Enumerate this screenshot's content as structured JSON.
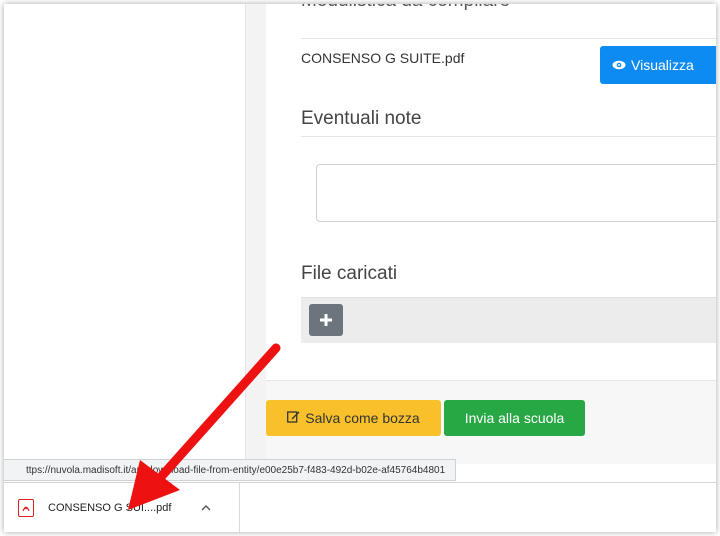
{
  "form": {
    "cut_heading": "Modulistica da compilare",
    "file_name": "CONSENSO G SUITE.pdf",
    "view_button": "Visualizza",
    "notes_title": "Eventuali note",
    "notes_value": "",
    "uploaded_title": "File caricati",
    "add_icon": "plus-icon"
  },
  "actions": {
    "save_draft": "Salva come bozza",
    "send_school": "Invia alla scuola"
  },
  "status_bar": {
    "url": "ttps://nuvola.madisoft.it/api/download-file-from-entity/e00e25b7-f483-492d-b02e-af45764b4801"
  },
  "downloads": {
    "file_label": "CONSENSO G SUI....pdf",
    "chevron_icon": "chevron-up-icon",
    "file_icon": "pdf-icon"
  },
  "colors": {
    "primary": "#0d8bf2",
    "warning": "#f8c12c",
    "success": "#28a745",
    "secondary": "#6c757d",
    "annotation_arrow": "#ee1111"
  }
}
